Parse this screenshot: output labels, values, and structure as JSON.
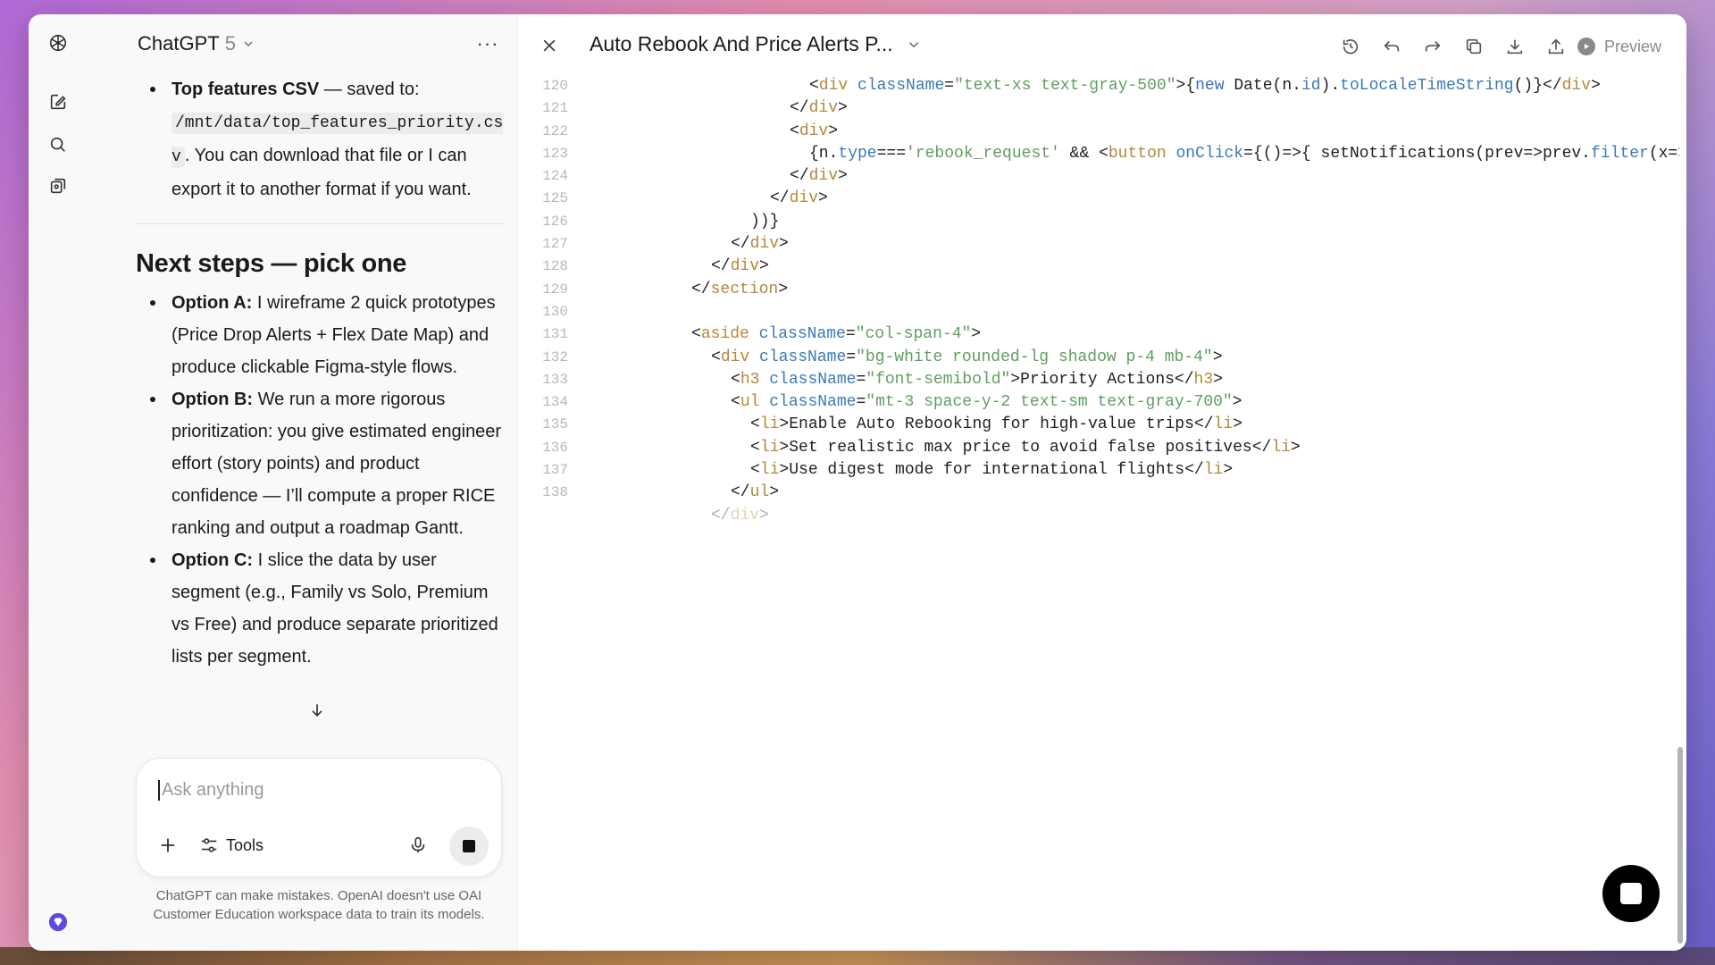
{
  "chat": {
    "model_name": "ChatGPT",
    "model_version": "5",
    "intro_item": {
      "bold": "Top features CSV",
      "text": " — saved to:",
      "path": "/mnt/data/top_features_priority.csv",
      "after": ". You can download that file or I can export it to another format if you want."
    },
    "section_title": "Next steps — pick one",
    "options": [
      {
        "label": "Option A:",
        "text": " I wireframe 2 quick prototypes (Price Drop Alerts + Flex Date Map) and produce clickable Figma-style flows."
      },
      {
        "label": "Option B:",
        "text": " We run a more rigorous prioritization: you give estimated engineer effort (story points) and product confidence — I’ll compute a proper RICE ranking and output a roadmap Gantt."
      },
      {
        "label": "Option C:",
        "text": " I slice the data by user segment (e.g., Family vs Solo, Premium vs Free) and produce separate prioritized lists per segment."
      }
    ],
    "composer_placeholder": "Ask anything",
    "tools_label": "Tools",
    "disclaimer": "ChatGPT can make mistakes. OpenAI doesn't use OAI Customer Education workspace data to train its models."
  },
  "canvas": {
    "title": "Auto Rebook And Price Alerts P...",
    "preview_label": "Preview",
    "code_lines": [
      {
        "n": "120",
        "indent": 14,
        "parts": [
          [
            "p",
            "<"
          ],
          [
            "tag",
            "div"
          ],
          [
            "p",
            " "
          ],
          [
            "attr",
            "className"
          ],
          [
            "p",
            "="
          ],
          [
            "str",
            "\"text-xs text-gray-500\""
          ],
          [
            "p",
            ">{"
          ],
          [
            "kw",
            "new"
          ],
          [
            "p",
            " Date(n."
          ],
          [
            "attr",
            "id"
          ],
          [
            "p",
            ")."
          ],
          [
            "mth",
            "toLocaleTimeString"
          ],
          [
            "p",
            "()}</"
          ],
          [
            "tag",
            "div"
          ],
          [
            "p",
            ">"
          ]
        ]
      },
      {
        "n": "121",
        "indent": 12,
        "parts": [
          [
            "p",
            "</"
          ],
          [
            "tag",
            "div"
          ],
          [
            "p",
            ">"
          ]
        ]
      },
      {
        "n": "122",
        "indent": 12,
        "parts": [
          [
            "p",
            "<"
          ],
          [
            "tag",
            "div"
          ],
          [
            "p",
            ">"
          ]
        ]
      },
      {
        "n": "123",
        "indent": 14,
        "parts": [
          [
            "p",
            "{n."
          ],
          [
            "attr",
            "type"
          ],
          [
            "p",
            "==="
          ],
          [
            "str",
            "'rebook_request'"
          ],
          [
            "p",
            " && <"
          ],
          [
            "tag",
            "button"
          ],
          [
            "p",
            " "
          ],
          [
            "attr",
            "onClick"
          ],
          [
            "p",
            "={()=>{ setNotifications(prev=>prev."
          ],
          [
            "mth",
            "filter"
          ],
          [
            "p",
            "(x=>x."
          ]
        ]
      },
      {
        "n": "124",
        "indent": 12,
        "parts": [
          [
            "p",
            "</"
          ],
          [
            "tag",
            "div"
          ],
          [
            "p",
            ">"
          ]
        ]
      },
      {
        "n": "125",
        "indent": 10,
        "parts": [
          [
            "p",
            "</"
          ],
          [
            "tag",
            "div"
          ],
          [
            "p",
            ">"
          ]
        ]
      },
      {
        "n": "126",
        "indent": 8,
        "parts": [
          [
            "p",
            "))}"
          ]
        ]
      },
      {
        "n": "127",
        "indent": 6,
        "parts": [
          [
            "p",
            "</"
          ],
          [
            "tag",
            "div"
          ],
          [
            "p",
            ">"
          ]
        ]
      },
      {
        "n": "128",
        "indent": 4,
        "parts": [
          [
            "p",
            "</"
          ],
          [
            "tag",
            "div"
          ],
          [
            "p",
            ">"
          ]
        ]
      },
      {
        "n": "129",
        "indent": 2,
        "parts": [
          [
            "p",
            "</"
          ],
          [
            "tag",
            "section"
          ],
          [
            "p",
            ">"
          ]
        ]
      },
      {
        "n": "130",
        "indent": 0,
        "parts": []
      },
      {
        "n": "131",
        "indent": 2,
        "parts": [
          [
            "p",
            "<"
          ],
          [
            "tag",
            "aside"
          ],
          [
            "p",
            " "
          ],
          [
            "attr",
            "className"
          ],
          [
            "p",
            "="
          ],
          [
            "str",
            "\"col-span-4\""
          ],
          [
            "p",
            ">"
          ]
        ]
      },
      {
        "n": "132",
        "indent": 4,
        "parts": [
          [
            "p",
            "<"
          ],
          [
            "tag",
            "div"
          ],
          [
            "p",
            " "
          ],
          [
            "attr",
            "className"
          ],
          [
            "p",
            "="
          ],
          [
            "str",
            "\"bg-white rounded-lg shadow p-4 mb-4\""
          ],
          [
            "p",
            ">"
          ]
        ]
      },
      {
        "n": "133",
        "indent": 6,
        "parts": [
          [
            "p",
            "<"
          ],
          [
            "tag",
            "h3"
          ],
          [
            "p",
            " "
          ],
          [
            "attr",
            "className"
          ],
          [
            "p",
            "="
          ],
          [
            "str",
            "\"font-semibold\""
          ],
          [
            "p",
            ">Priority Actions</"
          ],
          [
            "tag",
            "h3"
          ],
          [
            "p",
            ">"
          ]
        ]
      },
      {
        "n": "134",
        "indent": 6,
        "parts": [
          [
            "p",
            "<"
          ],
          [
            "tag",
            "ul"
          ],
          [
            "p",
            " "
          ],
          [
            "attr",
            "className"
          ],
          [
            "p",
            "="
          ],
          [
            "str",
            "\"mt-3 space-y-2 text-sm text-gray-700\""
          ],
          [
            "p",
            ">"
          ]
        ]
      },
      {
        "n": "135",
        "indent": 8,
        "parts": [
          [
            "p",
            "<"
          ],
          [
            "tag",
            "li"
          ],
          [
            "p",
            ">Enable Auto Rebooking for high-value trips</"
          ],
          [
            "tag",
            "li"
          ],
          [
            "p",
            ">"
          ]
        ]
      },
      {
        "n": "136",
        "indent": 8,
        "parts": [
          [
            "p",
            "<"
          ],
          [
            "tag",
            "li"
          ],
          [
            "p",
            ">Set realistic max price to avoid false positives</"
          ],
          [
            "tag",
            "li"
          ],
          [
            "p",
            ">"
          ]
        ]
      },
      {
        "n": "137",
        "indent": 8,
        "parts": [
          [
            "p",
            "<"
          ],
          [
            "tag",
            "li"
          ],
          [
            "p",
            ">Use digest mode for international flights</"
          ],
          [
            "tag",
            "li"
          ],
          [
            "p",
            ">"
          ]
        ]
      },
      {
        "n": "138",
        "indent": 6,
        "parts": [
          [
            "p",
            "</"
          ],
          [
            "tag",
            "ul"
          ],
          [
            "p",
            ">"
          ]
        ]
      },
      {
        "n": "",
        "indent": 4,
        "faded": true,
        "parts": [
          [
            "p",
            "</"
          ],
          [
            "tag",
            "div"
          ],
          [
            "p",
            ">"
          ]
        ]
      }
    ]
  },
  "colors": {
    "tag": "#b5873a",
    "attr": "#3a7ab5",
    "string": "#5f9e5f",
    "keyword": "#3a6fbf"
  },
  "icons": [
    "openai-logo-icon",
    "new-chat-icon",
    "search-icon",
    "library-icon",
    "upgrade-gem-icon",
    "chevron-down-icon",
    "more-icon",
    "close-icon",
    "history-icon",
    "undo-icon",
    "redo-icon",
    "copy-icon",
    "download-icon",
    "share-icon",
    "play-icon",
    "plus-icon",
    "tools-icon",
    "mic-icon",
    "stop-icon",
    "arrow-down-icon"
  ]
}
